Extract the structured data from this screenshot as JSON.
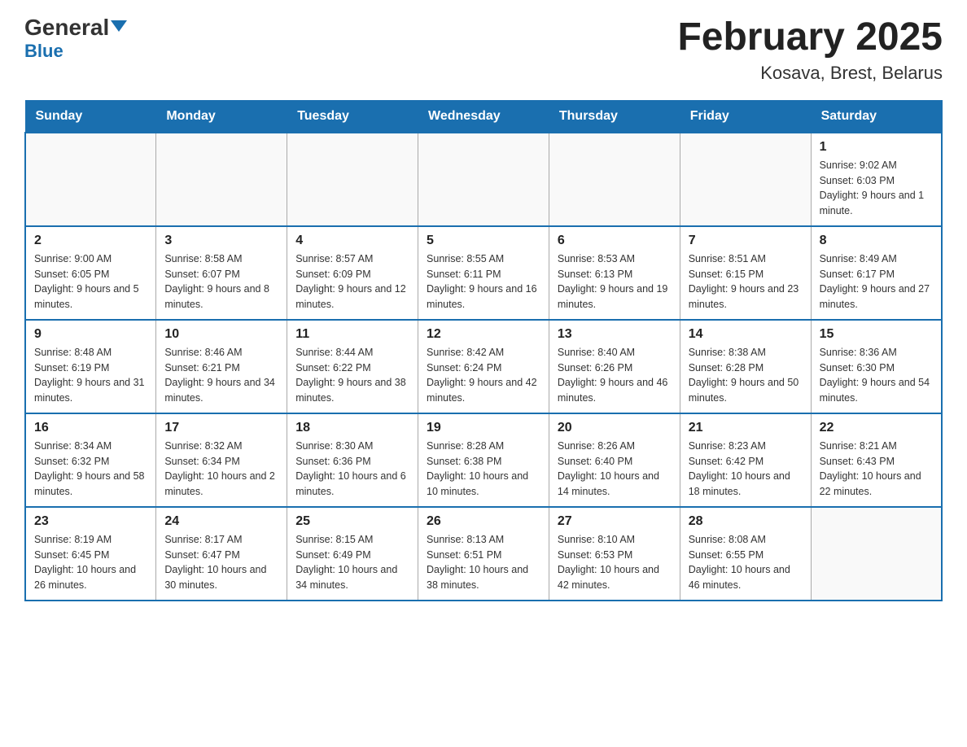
{
  "header": {
    "logo_general": "General",
    "logo_blue": "Blue",
    "title": "February 2025",
    "subtitle": "Kosava, Brest, Belarus"
  },
  "weekdays": [
    "Sunday",
    "Monday",
    "Tuesday",
    "Wednesday",
    "Thursday",
    "Friday",
    "Saturday"
  ],
  "weeks": [
    [
      {
        "day": "",
        "info": ""
      },
      {
        "day": "",
        "info": ""
      },
      {
        "day": "",
        "info": ""
      },
      {
        "day": "",
        "info": ""
      },
      {
        "day": "",
        "info": ""
      },
      {
        "day": "",
        "info": ""
      },
      {
        "day": "1",
        "info": "Sunrise: 9:02 AM\nSunset: 6:03 PM\nDaylight: 9 hours and 1 minute."
      }
    ],
    [
      {
        "day": "2",
        "info": "Sunrise: 9:00 AM\nSunset: 6:05 PM\nDaylight: 9 hours and 5 minutes."
      },
      {
        "day": "3",
        "info": "Sunrise: 8:58 AM\nSunset: 6:07 PM\nDaylight: 9 hours and 8 minutes."
      },
      {
        "day": "4",
        "info": "Sunrise: 8:57 AM\nSunset: 6:09 PM\nDaylight: 9 hours and 12 minutes."
      },
      {
        "day": "5",
        "info": "Sunrise: 8:55 AM\nSunset: 6:11 PM\nDaylight: 9 hours and 16 minutes."
      },
      {
        "day": "6",
        "info": "Sunrise: 8:53 AM\nSunset: 6:13 PM\nDaylight: 9 hours and 19 minutes."
      },
      {
        "day": "7",
        "info": "Sunrise: 8:51 AM\nSunset: 6:15 PM\nDaylight: 9 hours and 23 minutes."
      },
      {
        "day": "8",
        "info": "Sunrise: 8:49 AM\nSunset: 6:17 PM\nDaylight: 9 hours and 27 minutes."
      }
    ],
    [
      {
        "day": "9",
        "info": "Sunrise: 8:48 AM\nSunset: 6:19 PM\nDaylight: 9 hours and 31 minutes."
      },
      {
        "day": "10",
        "info": "Sunrise: 8:46 AM\nSunset: 6:21 PM\nDaylight: 9 hours and 34 minutes."
      },
      {
        "day": "11",
        "info": "Sunrise: 8:44 AM\nSunset: 6:22 PM\nDaylight: 9 hours and 38 minutes."
      },
      {
        "day": "12",
        "info": "Sunrise: 8:42 AM\nSunset: 6:24 PM\nDaylight: 9 hours and 42 minutes."
      },
      {
        "day": "13",
        "info": "Sunrise: 8:40 AM\nSunset: 6:26 PM\nDaylight: 9 hours and 46 minutes."
      },
      {
        "day": "14",
        "info": "Sunrise: 8:38 AM\nSunset: 6:28 PM\nDaylight: 9 hours and 50 minutes."
      },
      {
        "day": "15",
        "info": "Sunrise: 8:36 AM\nSunset: 6:30 PM\nDaylight: 9 hours and 54 minutes."
      }
    ],
    [
      {
        "day": "16",
        "info": "Sunrise: 8:34 AM\nSunset: 6:32 PM\nDaylight: 9 hours and 58 minutes."
      },
      {
        "day": "17",
        "info": "Sunrise: 8:32 AM\nSunset: 6:34 PM\nDaylight: 10 hours and 2 minutes."
      },
      {
        "day": "18",
        "info": "Sunrise: 8:30 AM\nSunset: 6:36 PM\nDaylight: 10 hours and 6 minutes."
      },
      {
        "day": "19",
        "info": "Sunrise: 8:28 AM\nSunset: 6:38 PM\nDaylight: 10 hours and 10 minutes."
      },
      {
        "day": "20",
        "info": "Sunrise: 8:26 AM\nSunset: 6:40 PM\nDaylight: 10 hours and 14 minutes."
      },
      {
        "day": "21",
        "info": "Sunrise: 8:23 AM\nSunset: 6:42 PM\nDaylight: 10 hours and 18 minutes."
      },
      {
        "day": "22",
        "info": "Sunrise: 8:21 AM\nSunset: 6:43 PM\nDaylight: 10 hours and 22 minutes."
      }
    ],
    [
      {
        "day": "23",
        "info": "Sunrise: 8:19 AM\nSunset: 6:45 PM\nDaylight: 10 hours and 26 minutes."
      },
      {
        "day": "24",
        "info": "Sunrise: 8:17 AM\nSunset: 6:47 PM\nDaylight: 10 hours and 30 minutes."
      },
      {
        "day": "25",
        "info": "Sunrise: 8:15 AM\nSunset: 6:49 PM\nDaylight: 10 hours and 34 minutes."
      },
      {
        "day": "26",
        "info": "Sunrise: 8:13 AM\nSunset: 6:51 PM\nDaylight: 10 hours and 38 minutes."
      },
      {
        "day": "27",
        "info": "Sunrise: 8:10 AM\nSunset: 6:53 PM\nDaylight: 10 hours and 42 minutes."
      },
      {
        "day": "28",
        "info": "Sunrise: 8:08 AM\nSunset: 6:55 PM\nDaylight: 10 hours and 46 minutes."
      },
      {
        "day": "",
        "info": ""
      }
    ]
  ]
}
